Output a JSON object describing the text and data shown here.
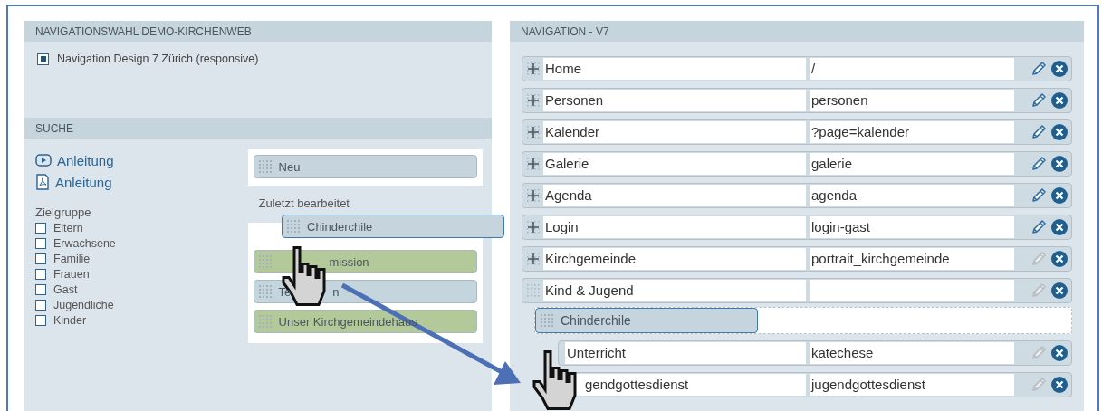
{
  "left_panel": {
    "title": "NAVIGATIONSWAHL DEMO-KIRCHENWEB",
    "options": [
      {
        "label": "Navigation Design 7 Zürich (responsive)",
        "selected": true
      }
    ],
    "search": {
      "title": "SUCHE",
      "links": [
        {
          "kind": "video",
          "label": "Anleitung"
        },
        {
          "kind": "pdf",
          "label": "Anleitung"
        }
      ],
      "target_group": {
        "label": "Zielgruppe",
        "items": [
          {
            "label": "Eltern",
            "checked": false
          },
          {
            "label": "Erwachsene",
            "checked": false
          },
          {
            "label": "Familie",
            "checked": false
          },
          {
            "label": "Frauen",
            "checked": false
          },
          {
            "label": "Gast",
            "checked": false
          },
          {
            "label": "Jugendliche",
            "checked": false
          },
          {
            "label": "Kinder",
            "checked": false
          }
        ]
      },
      "new_item": {
        "label": "Neu"
      },
      "recent": {
        "label": "Zuletzt bearbeitet",
        "items": [
          {
            "segments": [
              "mission"
            ],
            "covered_start": true,
            "color": "#b3c99a"
          },
          {
            "segments": [
              "Te",
              "n"
            ],
            "covered_start": false,
            "color": "#c5d5dd"
          },
          {
            "segments": [
              "Unser Kirchgemeindehaus"
            ],
            "covered_start": false,
            "color": "#b3c99a"
          }
        ]
      },
      "dragged_item": {
        "label": "Chinderchile"
      }
    }
  },
  "right_panel": {
    "title": "NAVIGATION - V7",
    "items": [
      {
        "kind": "row",
        "name": "Home",
        "url": "/",
        "editable": true
      },
      {
        "kind": "row",
        "name": "Personen",
        "url": "personen",
        "editable": true
      },
      {
        "kind": "row",
        "name": "Kalender",
        "url": "?page=kalender",
        "editable": true
      },
      {
        "kind": "row",
        "name": "Galerie",
        "url": "galerie",
        "editable": true
      },
      {
        "kind": "row",
        "name": "Agenda",
        "url": "agenda",
        "editable": true
      },
      {
        "kind": "row",
        "name": "Login",
        "url": "login-gast",
        "editable": true
      },
      {
        "kind": "row",
        "name": "Kirchgemeinde",
        "url": "portrait_kirchgemeinde",
        "editable": false
      },
      {
        "kind": "group",
        "name": "Kind & Jugend",
        "editable": false,
        "children": [
          {
            "kind": "drop",
            "label": "Chinderchile"
          },
          {
            "kind": "row",
            "name": "Unterricht",
            "url": "katechese",
            "editable": false,
            "covered_start": false
          },
          {
            "kind": "row",
            "name": "gendgottesdienst",
            "url": "jugendgottesdienst",
            "editable": false,
            "covered_start": true
          }
        ]
      }
    ]
  }
}
